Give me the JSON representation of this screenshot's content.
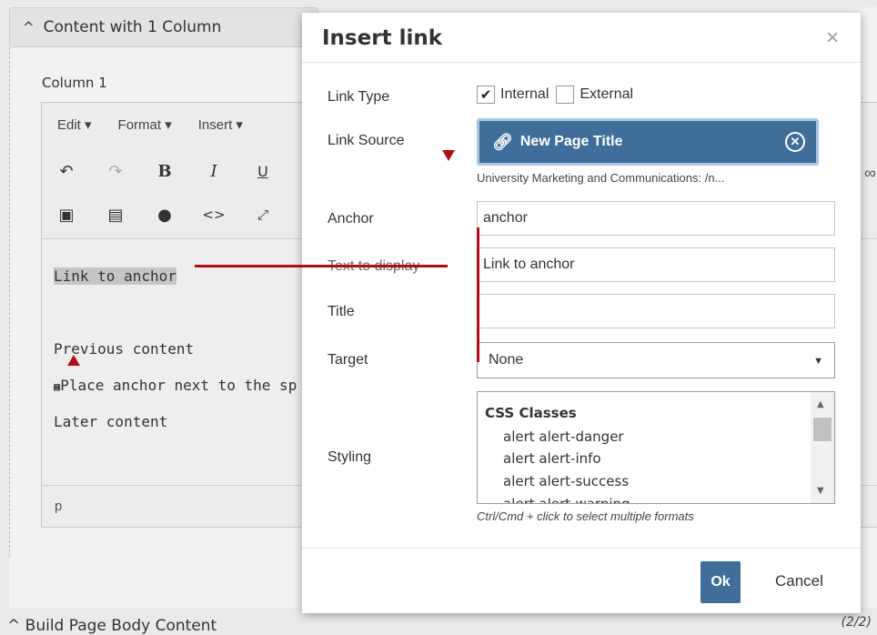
{
  "background": {
    "section_title": "Content with 1 Column",
    "column_label": "Column 1",
    "menubar": [
      "Edit ▾",
      "Format ▾",
      "Insert ▾"
    ],
    "content": {
      "selected_link": "Link to anchor",
      "line1": "Previous content",
      "line2": "Place anchor next to the sp",
      "line3": "Later content"
    },
    "status_path": "p",
    "bottom_section": "Build Page Body Content",
    "bottom_counter": "(2/2)"
  },
  "modal": {
    "title": "Insert link",
    "close_symbol": "×",
    "labels": {
      "link_type": "Link Type",
      "link_source": "Link Source",
      "anchor": "Anchor",
      "text_to_display": "Text to display",
      "title": "Title",
      "target": "Target",
      "styling": "Styling"
    },
    "link_type": {
      "internal_label": "Internal",
      "internal_checked": true,
      "external_label": "External",
      "external_checked": false
    },
    "link_source": {
      "page_title": "New Page Title",
      "path": "University Marketing and Communications: /n..."
    },
    "anchor_value": "anchor",
    "text_to_display_value": "Link to anchor",
    "title_value": "",
    "target_value": "None",
    "styling": {
      "group": "CSS Classes",
      "options": [
        "alert alert-danger",
        "alert alert-info",
        "alert alert-success",
        "alert alert-warning"
      ]
    },
    "hint": "Ctrl/Cmd + click to select multiple formats",
    "ok_label": "Ok",
    "cancel_label": "Cancel"
  },
  "colors": {
    "primary": "#3f6e9b",
    "annotation": "#b10d16"
  }
}
